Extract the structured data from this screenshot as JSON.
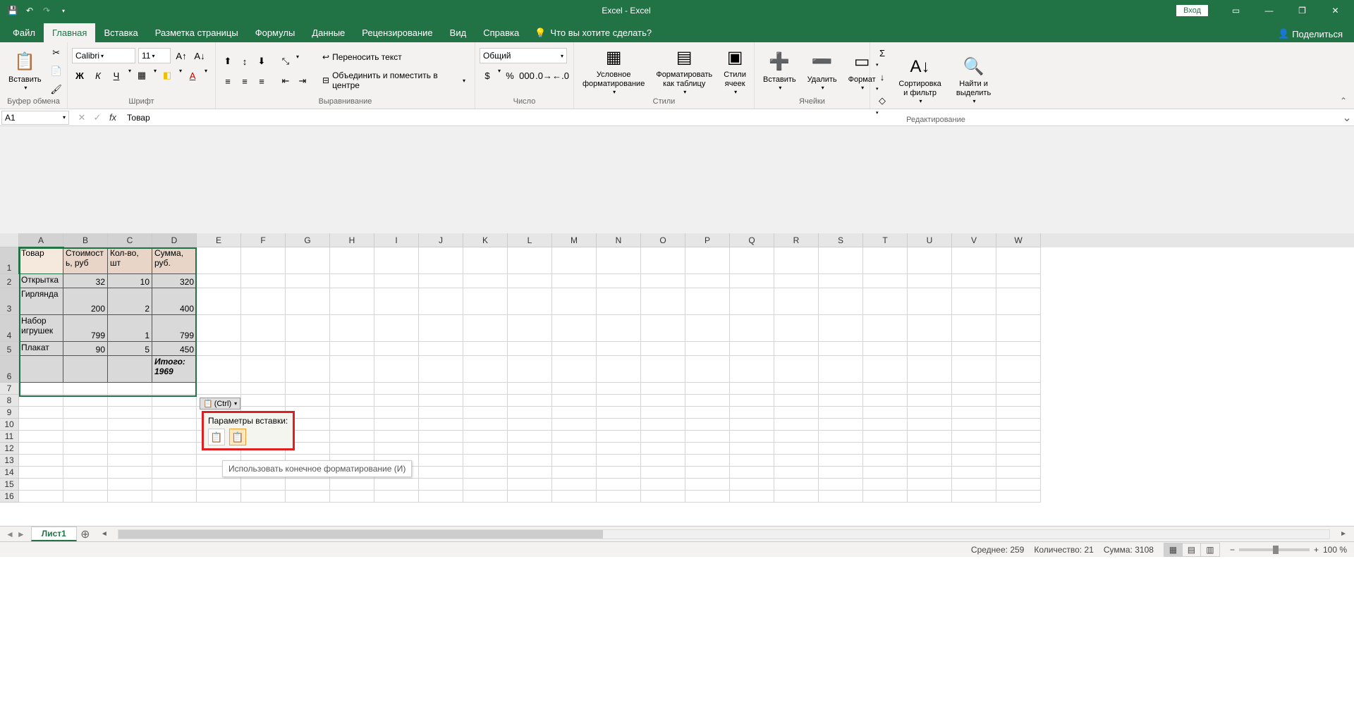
{
  "titlebar": {
    "title": "Excel  -  Excel",
    "signin": "Вход"
  },
  "tabs": [
    "Файл",
    "Главная",
    "Вставка",
    "Разметка страницы",
    "Формулы",
    "Данные",
    "Рецензирование",
    "Вид",
    "Справка"
  ],
  "active_tab": 1,
  "tellme": "Что вы хотите сделать?",
  "share": "Поделиться",
  "ribbon": {
    "clipboard": {
      "label": "Буфер обмена",
      "paste": "Вставить"
    },
    "font": {
      "label": "Шрифт",
      "name": "Calibri",
      "size": "11",
      "bold": "Ж",
      "italic": "К",
      "underline": "Ч"
    },
    "alignment": {
      "label": "Выравнивание",
      "wrap": "Переносить текст",
      "merge": "Объединить и поместить в центре"
    },
    "number": {
      "label": "Число",
      "format": "Общий"
    },
    "styles": {
      "label": "Стили",
      "cond": "Условное форматирование",
      "table": "Форматировать как таблицу",
      "cell": "Стили ячеек"
    },
    "cells": {
      "label": "Ячейки",
      "insert": "Вставить",
      "delete": "Удалить",
      "format": "Формат"
    },
    "editing": {
      "label": "Редактирование",
      "sort": "Сортировка и фильтр",
      "find": "Найти и выделить"
    }
  },
  "namebox": "A1",
  "formula": "Товар",
  "columns": [
    "A",
    "B",
    "C",
    "D",
    "E",
    "F",
    "G",
    "H",
    "I",
    "J",
    "K",
    "L",
    "M",
    "N",
    "O",
    "P",
    "Q",
    "R",
    "S",
    "T",
    "U",
    "V",
    "W"
  ],
  "row_heights": {
    "1": 38,
    "2": 20,
    "3": 38,
    "4": 38,
    "5": 20,
    "6": 38,
    "7": 17,
    "8": 17,
    "9": 17,
    "10": 17,
    "11": 17,
    "12": 17,
    "13": 17,
    "14": 17,
    "15": 17,
    "16": 17
  },
  "table": {
    "headers": [
      "Товар",
      "Стоимость, руб",
      "Кол-во, шт",
      "Сумма, руб."
    ],
    "rows": [
      [
        "Открытка",
        "32",
        "10",
        "320"
      ],
      [
        "Гирлянда",
        "200",
        "2",
        "400"
      ],
      [
        "Набор игрушек",
        "799",
        "1",
        "799"
      ],
      [
        "Плакат",
        "90",
        "5",
        "450"
      ]
    ],
    "total": "Итого: 1969"
  },
  "smarttag": {
    "ctrl": "(Ctrl)",
    "title": "Параметры вставки:"
  },
  "tooltip": "Использовать конечное форматирование (И)",
  "sheet": "Лист1",
  "status": {
    "avg_label": "Среднее:",
    "avg": "259",
    "count_label": "Количество:",
    "count": "21",
    "sum_label": "Сумма:",
    "sum": "3108",
    "zoom": "100 %"
  }
}
